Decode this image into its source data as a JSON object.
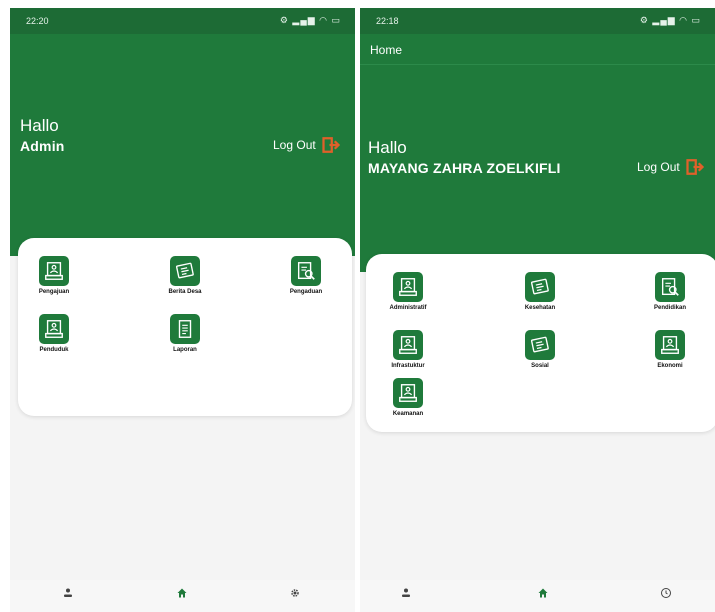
{
  "left": {
    "status_time": "22:20",
    "greeting": "Hallo",
    "user_name": "Admin",
    "logout_label": "Log Out",
    "menu": [
      {
        "label": "Pengajuan",
        "icon": "form-icon"
      },
      {
        "label": "Berita Desa",
        "icon": "newspaper-icon"
      },
      {
        "label": "Pengaduan",
        "icon": "report-icon"
      },
      {
        "label": "Penduduk",
        "icon": "form-icon"
      },
      {
        "label": "Laporan",
        "icon": "document-icon"
      }
    ]
  },
  "right": {
    "status_time": "22:18",
    "appbar_title": "Home",
    "greeting": "Hallo",
    "user_name": "MAYANG ZAHRA ZOELKIFLI",
    "logout_label": "Log Out",
    "menu": [
      {
        "label": "Administratif",
        "icon": "form-icon"
      },
      {
        "label": "Kesehatan",
        "icon": "newspaper-icon"
      },
      {
        "label": "Pendidikan",
        "icon": "report-icon"
      },
      {
        "label": "Infrastuktur",
        "icon": "form-icon"
      },
      {
        "label": "Sosial",
        "icon": "newspaper-icon"
      },
      {
        "label": "Ekonomi",
        "icon": "form-icon"
      },
      {
        "label": "Keamanan",
        "icon": "form-icon"
      }
    ]
  },
  "colors": {
    "primary": "#1f7a3b",
    "logout_icon": "#e0602a"
  }
}
